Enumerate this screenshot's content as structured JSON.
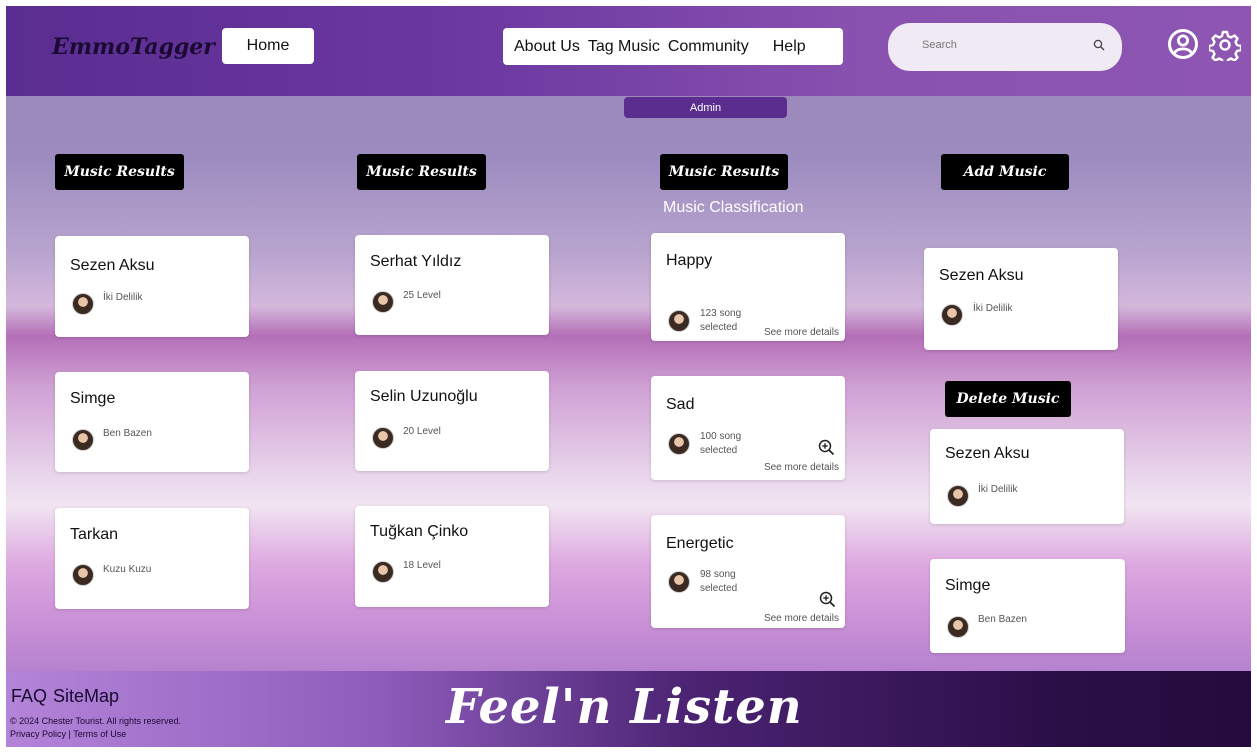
{
  "header": {
    "logo": "EmmoTagger",
    "home": "Home",
    "nav": [
      "About Us",
      "Tag Music",
      "Community",
      "Help"
    ],
    "search_placeholder": "Search",
    "icons": [
      "search-icon",
      "user-icon",
      "gear-icon"
    ]
  },
  "admin_label": "Admin",
  "columns": {
    "col1": {
      "button": "Music Results",
      "cards": [
        {
          "title": "Sezen Aksu",
          "sub": "İki Delilik"
        },
        {
          "title": "Simge",
          "sub": "Ben Bazen"
        },
        {
          "title": "Tarkan",
          "sub": "Kuzu Kuzu"
        }
      ]
    },
    "col2": {
      "button": "Music Results",
      "cards": [
        {
          "title": "Serhat Yıldız",
          "sub": "25 Level"
        },
        {
          "title": "Selin Uzunoğlu",
          "sub": "20 Level"
        },
        {
          "title": "Tuğkan Çinko",
          "sub": "18 Level"
        }
      ]
    },
    "col3": {
      "button": "Music Results",
      "heading": "Music Classification",
      "cards": [
        {
          "title": "Happy",
          "count": "123 song",
          "selected": "selected",
          "more": "See more details"
        },
        {
          "title": "Sad",
          "count": "100 song",
          "selected": "selected",
          "more": "See more details"
        },
        {
          "title": "Energetic",
          "count": "98 song",
          "selected": "selected",
          "more": "See more details"
        }
      ]
    },
    "col4": {
      "add_button": "Add Music",
      "add_card": {
        "title": "Sezen Aksu",
        "sub": "İki Delilik"
      },
      "delete_button": "Delete Music",
      "delete_cards": [
        {
          "title": "Sezen Aksu",
          "sub": "İki Delilik"
        },
        {
          "title": "Simge",
          "sub": "Ben Bazen"
        }
      ]
    }
  },
  "footer": {
    "faq": "FAQ",
    "sitemap": "SiteMap",
    "copyright": "© 2024 Chester Tourist. All rights reserved.",
    "privacy": "Privacy Policy",
    "terms": "Terms of Use",
    "brand": "Feel'n Listen"
  }
}
